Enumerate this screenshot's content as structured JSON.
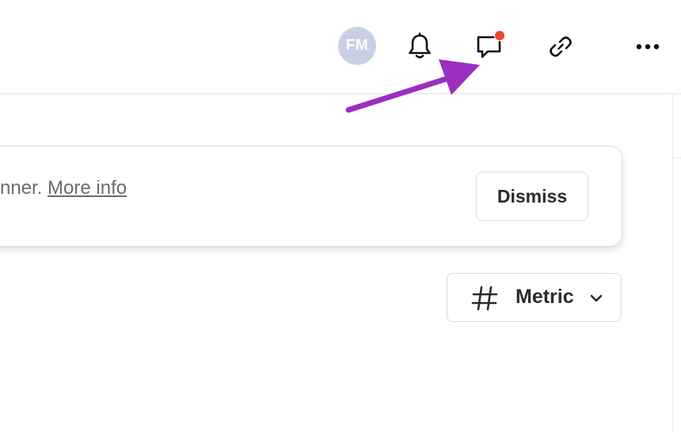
{
  "header": {
    "avatar_initials": "FM",
    "icons": [
      "bell-icon",
      "chat-icon",
      "link-icon",
      "more-icon"
    ],
    "has_unread_comments": true
  },
  "banner": {
    "text": "nner. ",
    "link_text": "More info",
    "dismiss_label": "Dismiss"
  },
  "metric_selector": {
    "label": "Metric",
    "icon": "hash-icon"
  },
  "annotation": {
    "type": "arrow",
    "color": "#9b2fc1",
    "points_to": "chat-icon"
  },
  "colors": {
    "avatar_bg": "#c9d0e6",
    "notification_dot": "#e8472e",
    "text": "#2b2b2b",
    "muted_text": "#6b6b6b"
  }
}
